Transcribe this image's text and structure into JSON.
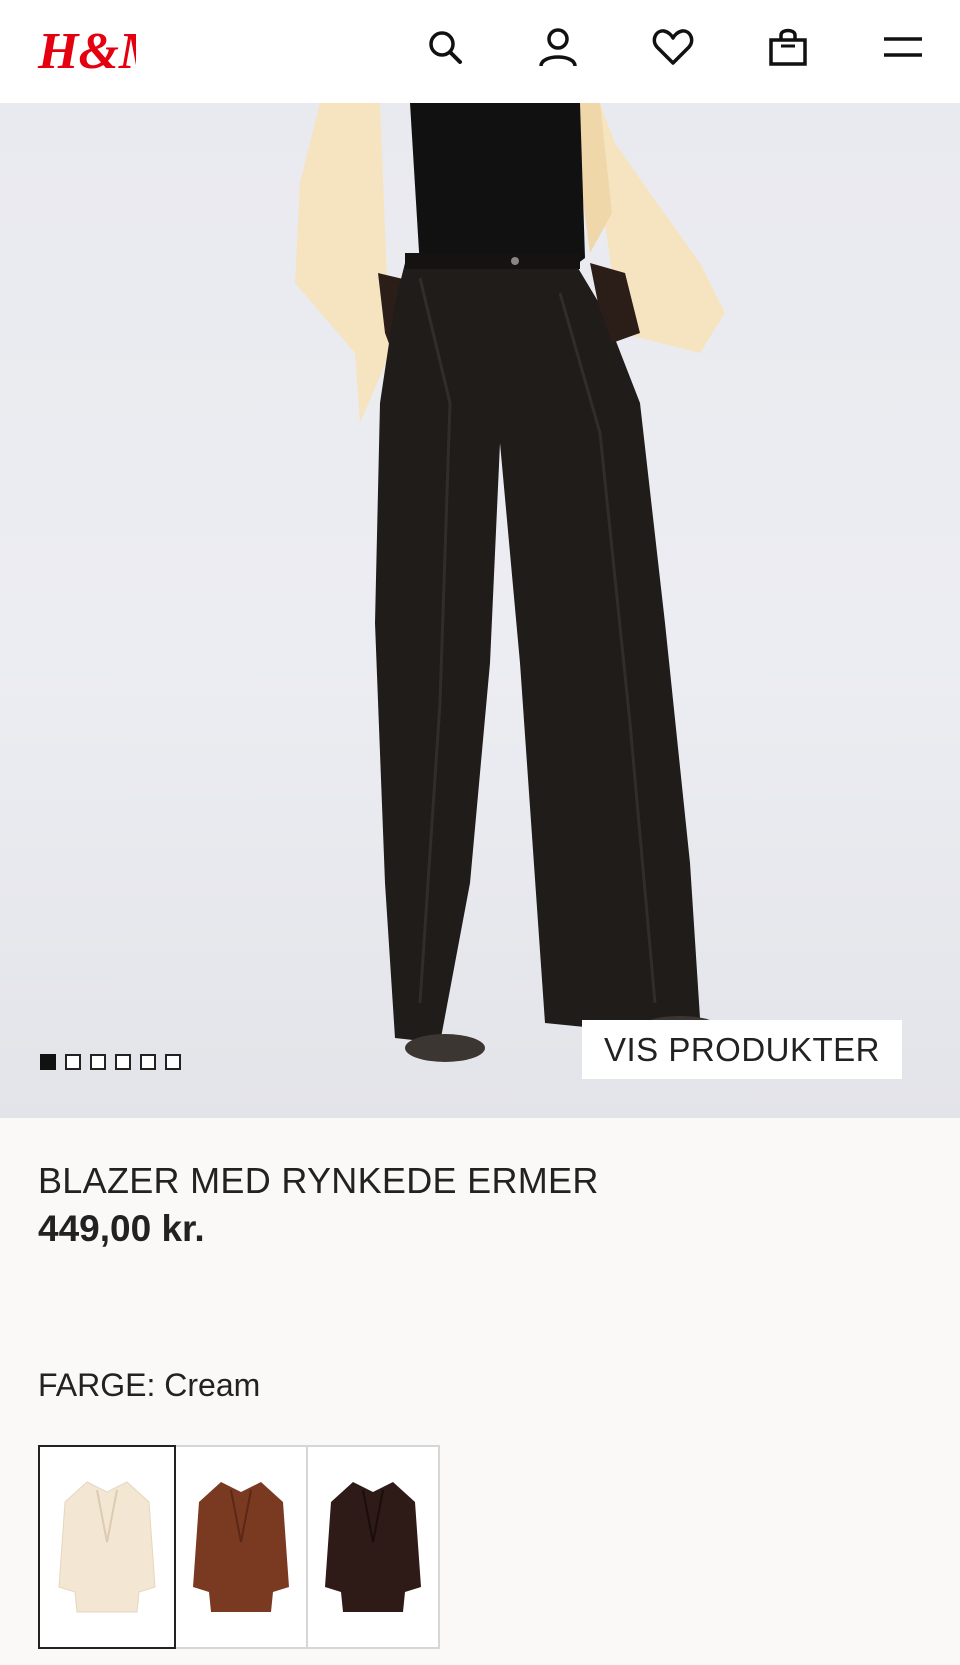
{
  "header": {
    "logo_text": "H&M",
    "icons": [
      "search-icon",
      "account-icon",
      "heart-icon",
      "bag-icon",
      "menu-icon"
    ]
  },
  "gallery": {
    "image_count": 6,
    "active_index": 0,
    "cta_label": "VIS PRODUKTER"
  },
  "product": {
    "title": "BLAZER MED RYNKEDE ERMER",
    "price": "449,00 kr.",
    "color_label": "FARGE:",
    "color_value": "Cream",
    "color_line": "FARGE: Cream",
    "swatches": [
      {
        "name": "cream",
        "color": "#f3e6d3",
        "selected": true
      },
      {
        "name": "brown",
        "color": "#7a3a22",
        "selected": false
      },
      {
        "name": "dark-brown",
        "color": "#2e1a17",
        "selected": false
      }
    ]
  },
  "colors": {
    "brand_red": "#e50010",
    "text": "#222222",
    "background": "#faf9f8"
  }
}
